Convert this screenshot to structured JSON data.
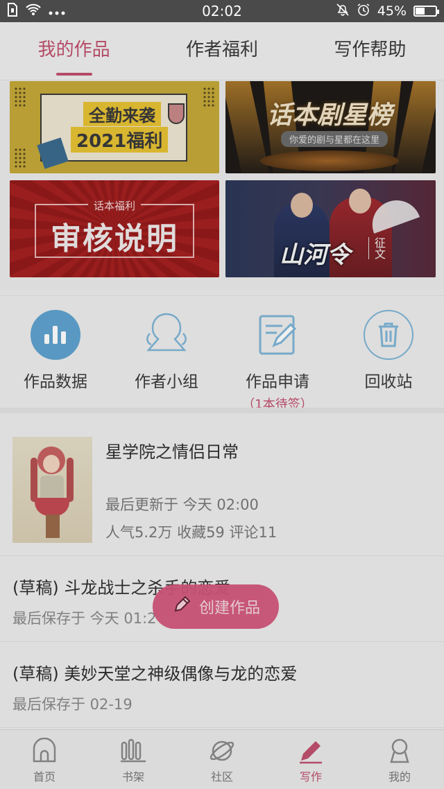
{
  "status_bar": {
    "time": "02:02",
    "battery": "45%",
    "battery_level": 0.45,
    "icons": [
      "sim-icon",
      "wifi-icon",
      "more-dots-icon",
      "mute-icon",
      "alarm-icon",
      "battery-icon"
    ]
  },
  "tabs": [
    {
      "label": "我的作品",
      "active": true
    },
    {
      "label": "作者福利",
      "active": false
    },
    {
      "label": "写作帮助",
      "active": false
    }
  ],
  "banners": {
    "welfare": {
      "line1": "全勤来袭",
      "line2": "2021福利"
    },
    "star_rank": {
      "title": "话本剧星榜",
      "subtitle": "你爱的剧与星都在这里"
    },
    "review": {
      "tag": "话本福利",
      "title": "审核说明"
    },
    "contest": {
      "title": "山河令",
      "tag": "征文"
    }
  },
  "actions": [
    {
      "label": "作品数据",
      "icon": "bar-chart-icon"
    },
    {
      "label": "作者小组",
      "icon": "group-icon"
    },
    {
      "label": "作品申请",
      "sub": "（1本待签）",
      "icon": "edit-doc-icon"
    },
    {
      "label": "回收站",
      "icon": "trash-icon"
    }
  ],
  "works": {
    "main": {
      "title": "星学院之情侣日常",
      "update": "最后更新于 今天 02:00",
      "stats": "人气5.2万 收藏59 评论11"
    },
    "drafts": [
      {
        "title": "(草稿) 斗龙战士之杀手的恋爱",
        "time": "最后保存于 今天 01:2"
      },
      {
        "title": "(草稿) 美妙天堂之神级偶像与龙的恋爱",
        "time": "最后保存于 02-19"
      }
    ]
  },
  "fab": {
    "label": "创建作品",
    "icon": "pencil-icon"
  },
  "bottom_nav": [
    {
      "label": "首页",
      "icon": "home-icon",
      "active": false
    },
    {
      "label": "书架",
      "icon": "bookshelf-icon",
      "active": false
    },
    {
      "label": "社区",
      "icon": "planet-icon",
      "active": false
    },
    {
      "label": "写作",
      "icon": "pen-icon",
      "active": true
    },
    {
      "label": "我的",
      "icon": "profile-icon",
      "active": false
    }
  ],
  "colors": {
    "accent": "#c0506e",
    "icon_blue": "#5fa2cf",
    "fab": "#d3567c"
  }
}
